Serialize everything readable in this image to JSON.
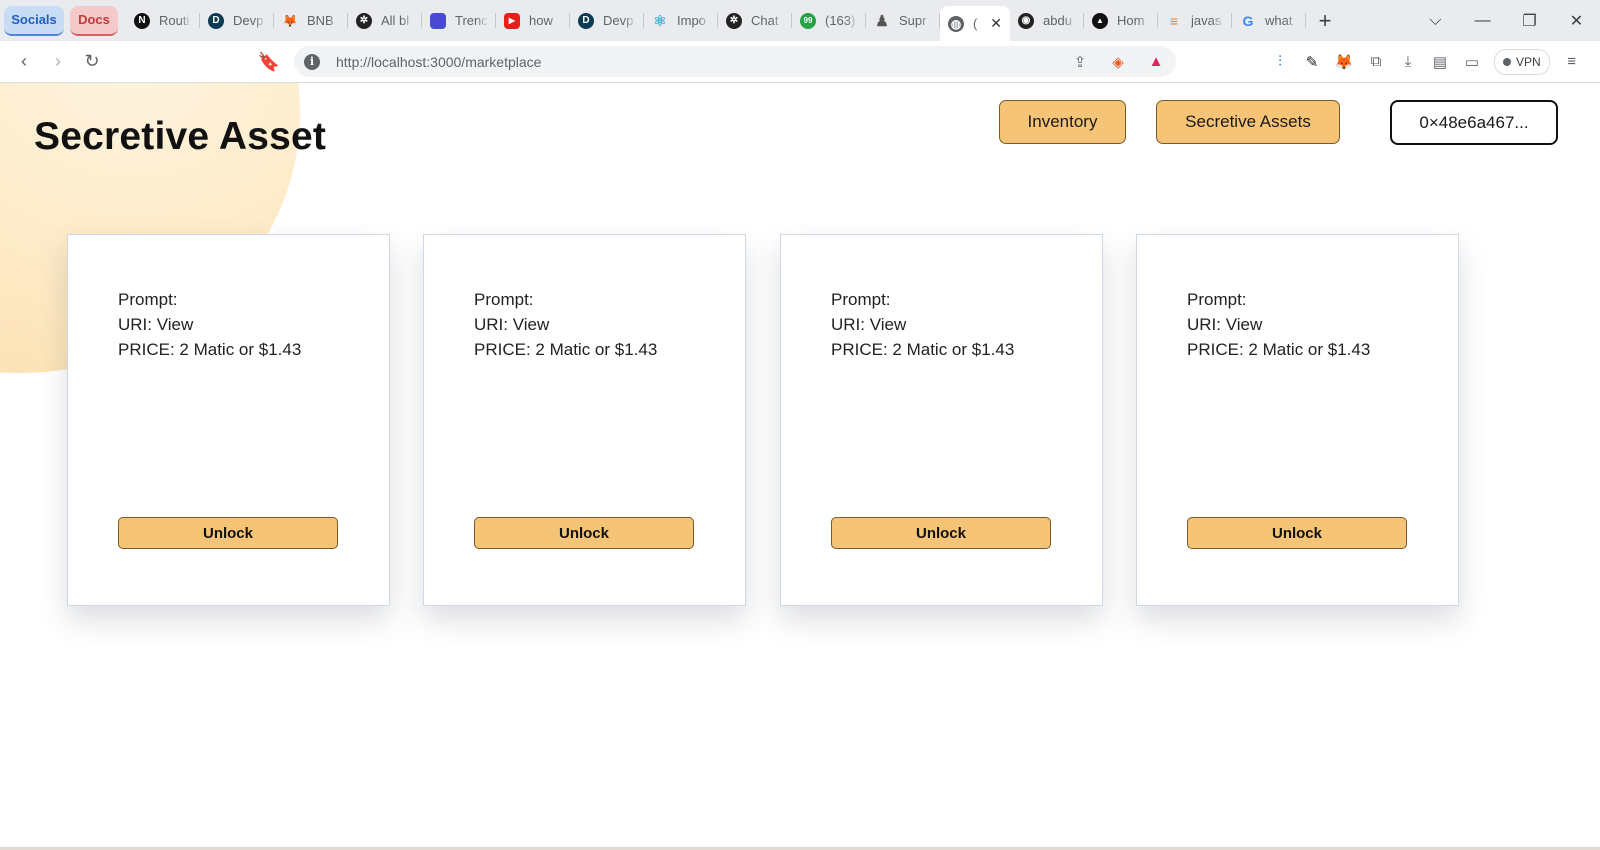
{
  "browser": {
    "tab_groups": [
      {
        "label": "Socials"
      },
      {
        "label": "Docs"
      }
    ],
    "tabs": [
      {
        "label": "Routi",
        "icon": "nextjs-icon",
        "fav": "N",
        "color": "#111111"
      },
      {
        "label": "Devp",
        "icon": "devpost-icon",
        "fav": "D",
        "color": "#0b3a53"
      },
      {
        "label": "BNB",
        "icon": "fox-icon",
        "fav": "🦊",
        "color": "#ffffff"
      },
      {
        "label": "All bl",
        "icon": "openai-icon",
        "fav": "✲",
        "color": "#222222"
      },
      {
        "label": "Trenc",
        "icon": "app-icon",
        "fav": "",
        "color": "#4a4ad0"
      },
      {
        "label": "how",
        "icon": "youtube-icon",
        "fav": "▶",
        "color": "#e62117"
      },
      {
        "label": "Devp",
        "icon": "devpost-icon",
        "fav": "D",
        "color": "#0b3a53"
      },
      {
        "label": "Impo",
        "icon": "react-icon",
        "fav": "⚛",
        "color": "#ffffff"
      },
      {
        "label": "Chat",
        "icon": "openai-icon",
        "fav": "✲",
        "color": "#222222"
      },
      {
        "label": "(163)",
        "icon": "whatsapp-icon",
        "fav": "99",
        "color": "#25a244"
      },
      {
        "label": "Supr",
        "icon": "chess-icon",
        "fav": "♟",
        "color": "#ffffff"
      },
      {
        "label": "(",
        "icon": "globe-icon",
        "fav": "◍",
        "color": "#5f6368",
        "active": true
      },
      {
        "label": "abdu",
        "icon": "github-icon",
        "fav": "◉",
        "color": "#ffffff"
      },
      {
        "label": "Hom",
        "icon": "vercel-icon",
        "fav": "▲",
        "color": "#111111"
      },
      {
        "label": "javas",
        "icon": "stackoverflow-icon",
        "fav": "≡",
        "color": "#ffffff"
      },
      {
        "label": "what",
        "icon": "google-icon",
        "fav": "G",
        "color": "#ffffff"
      }
    ],
    "url": "http://localhost:3000/marketplace",
    "vpn_label": "VPN"
  },
  "page": {
    "title": "Secretive Asset",
    "nav": {
      "inventory_label": "Inventory",
      "assets_label": "Secretive Assets",
      "wallet_label": "0×48e6a467..."
    },
    "cards": [
      {
        "prompt": "Prompt:",
        "uri": "URI: View",
        "price": "PRICE: 2 Matic or $1.43",
        "button": "Unlock"
      },
      {
        "prompt": "Prompt:",
        "uri": "URI: View",
        "price": "PRICE: 2 Matic or $1.43",
        "button": "Unlock"
      },
      {
        "prompt": "Prompt:",
        "uri": "URI: View",
        "price": "PRICE: 2 Matic or $1.43",
        "button": "Unlock"
      },
      {
        "prompt": "Prompt:",
        "uri": "URI: View",
        "price": "PRICE: 2 Matic or $1.43",
        "button": "Unlock"
      }
    ]
  },
  "colors": {
    "accent": "#f5c477",
    "accent_border": "#7a5a2a"
  }
}
